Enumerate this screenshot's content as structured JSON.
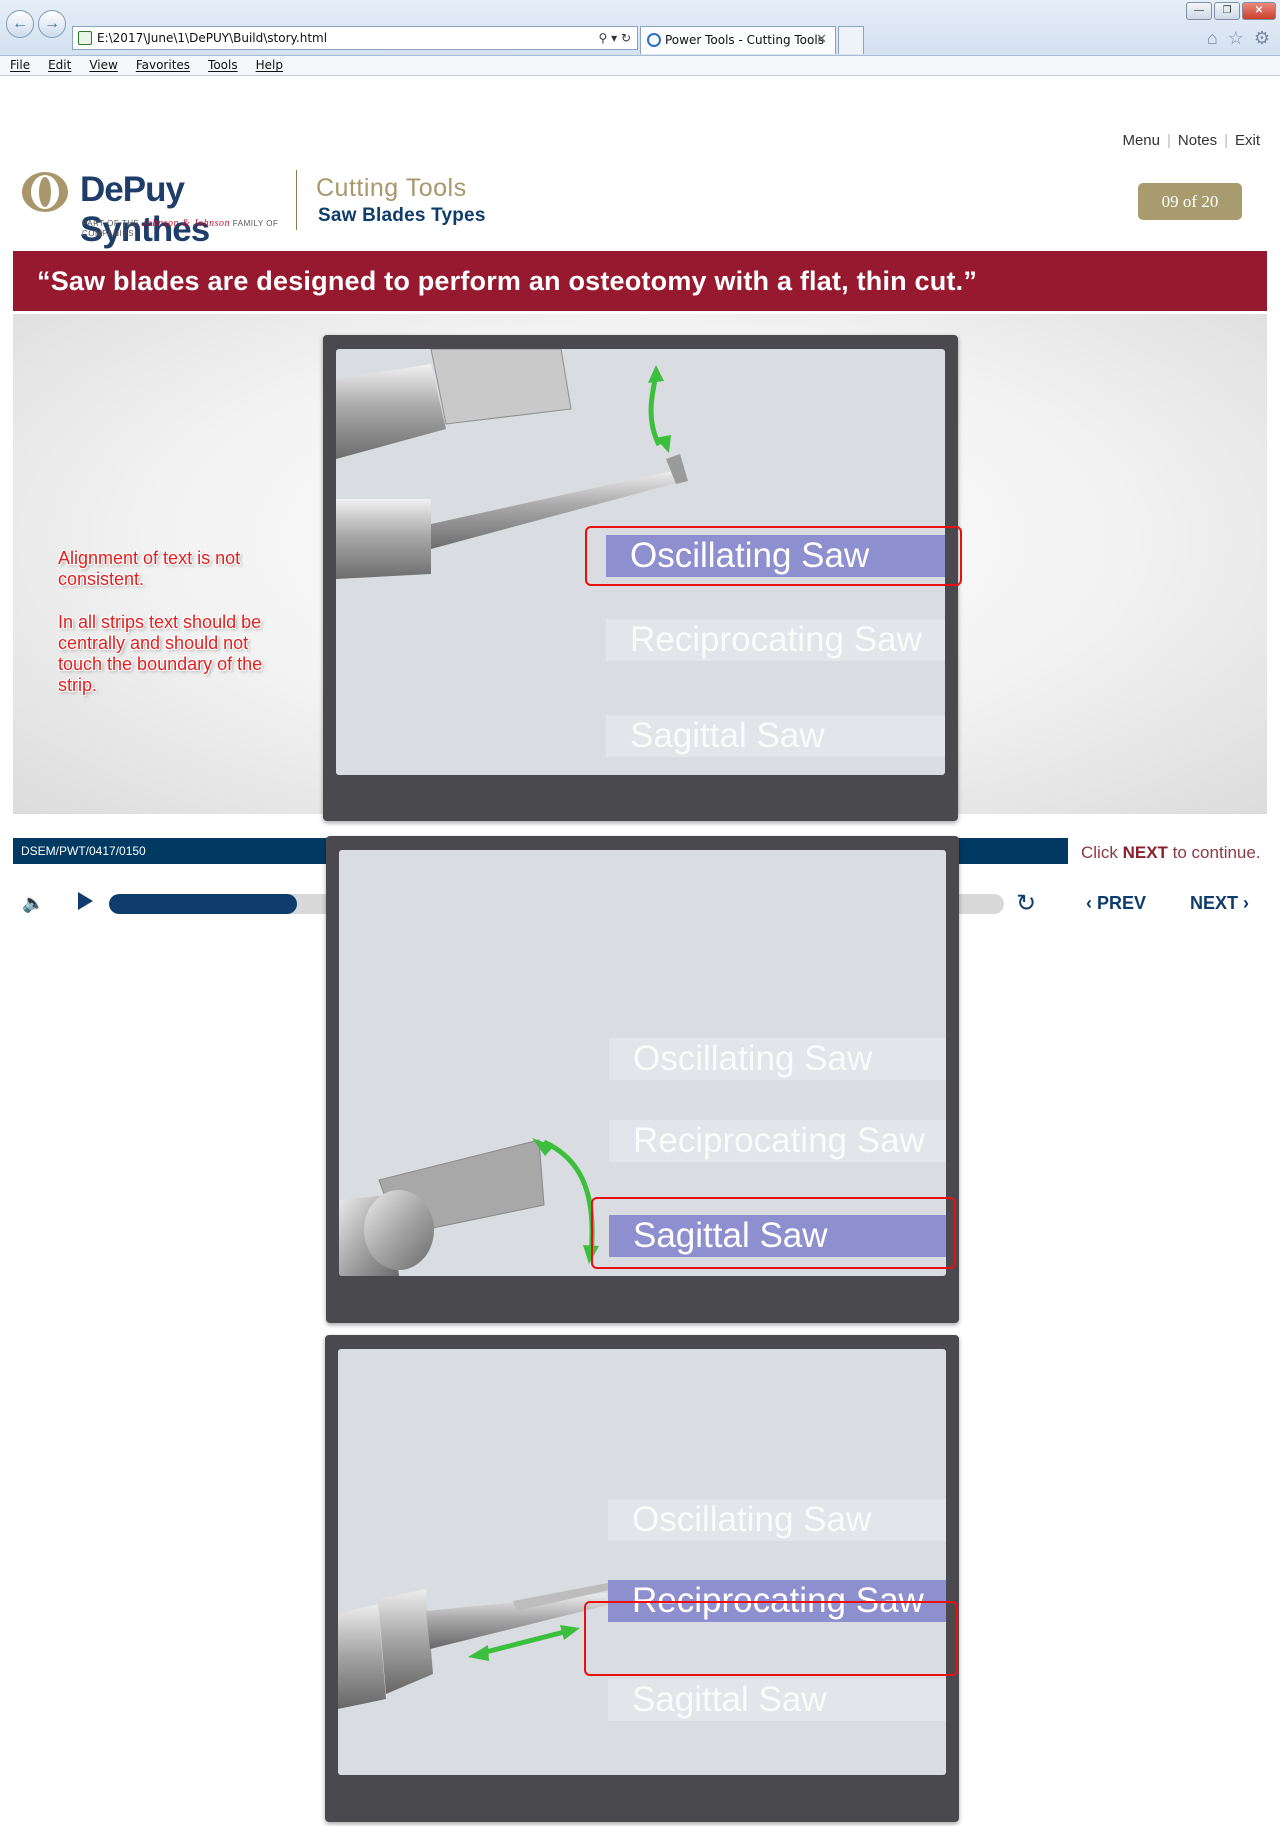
{
  "browser": {
    "address": "E:\\2017\\June\\1\\DePUY\\Build\\story.html",
    "tab_title": "Power Tools - Cutting Tools",
    "menu": [
      "File",
      "Edit",
      "View",
      "Favorites",
      "Tools",
      "Help"
    ]
  },
  "player": {
    "nav": {
      "menu": "Menu",
      "notes": "Notes",
      "exit": "Exit"
    },
    "logo": {
      "wordmark": "DePuy Synthes",
      "tagline_prefix": "PART OF THE",
      "tagline_brand": "Johnson & Johnson",
      "tagline_suffix": "FAMILY OF COMPANIES"
    },
    "course_title": "Cutting Tools",
    "course_subtitle": "Saw Blades Types",
    "page_indicator": "09 of 20",
    "quote": "“Saw blades are designed to perform an osteotomy with a flat, thin cut.”",
    "code": "DSEM/PWT/0417/0150",
    "click_prefix": "Click",
    "click_next": "NEXT",
    "click_suffix": "to continue.",
    "prev_label": "PREV",
    "next_label": "NEXT",
    "progress": 0.21
  },
  "annotation": {
    "line1": "Alignment of text is not consistent.",
    "line2": "In all strips text should be centrally and should not touch the boundary of the strip."
  },
  "panels": [
    {
      "strips": [
        {
          "label": "Oscillating Saw",
          "active": true
        },
        {
          "label": "Reciprocating Saw",
          "active": false
        },
        {
          "label": "Sagittal Saw",
          "active": false
        }
      ]
    },
    {
      "strips": [
        {
          "label": "Oscillating Saw",
          "active": false
        },
        {
          "label": "Reciprocating Saw",
          "active": false
        },
        {
          "label": "Sagittal Saw",
          "active": true
        }
      ]
    },
    {
      "strips": [
        {
          "label": "Oscillating Saw",
          "active": false
        },
        {
          "label": "Reciprocating Saw",
          "active": true
        },
        {
          "label": "Sagittal Saw",
          "active": false
        }
      ]
    }
  ],
  "colors": {
    "banner": "#97192f",
    "navy": "#0e3c6b",
    "gold": "#a89b6e",
    "strip_active": "#8d8fcf",
    "annotation": "#e02020"
  }
}
